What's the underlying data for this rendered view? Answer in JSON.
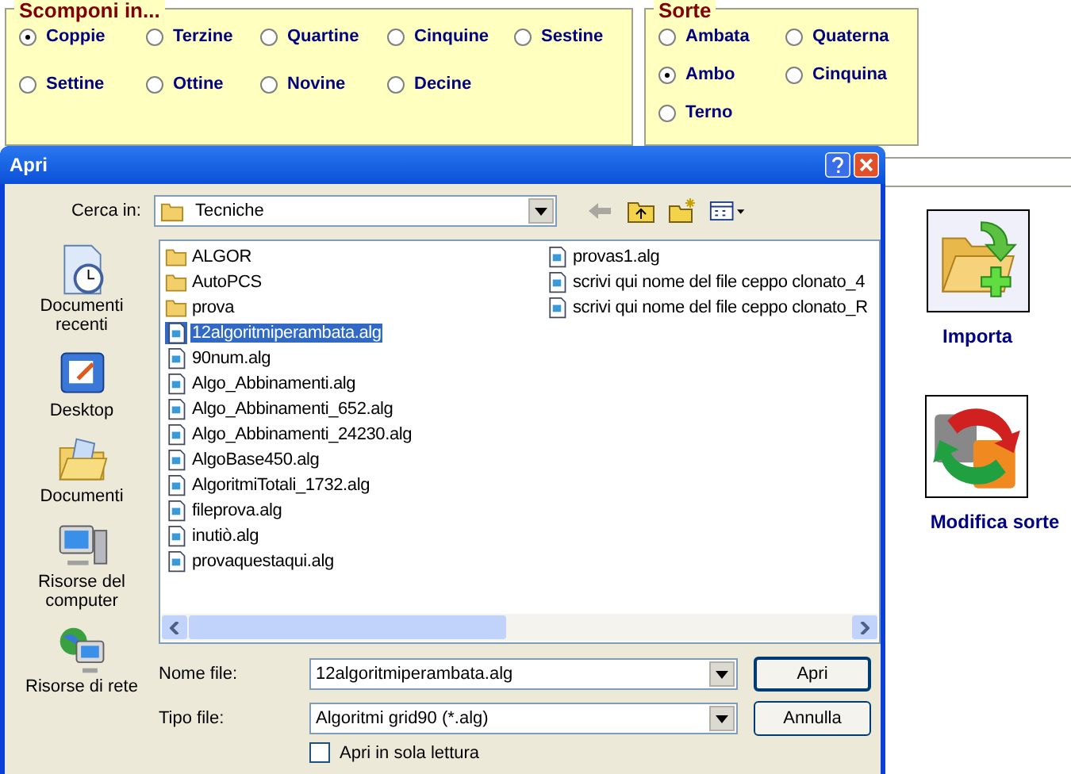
{
  "scomponi": {
    "title": "Scomponi in...",
    "options": [
      {
        "label": "Coppie",
        "selected": true
      },
      {
        "label": "Terzine",
        "selected": false
      },
      {
        "label": "Quartine",
        "selected": false
      },
      {
        "label": "Cinquine",
        "selected": false
      },
      {
        "label": "Sestine",
        "selected": false
      },
      {
        "label": "Settine",
        "selected": false
      },
      {
        "label": "Ottine",
        "selected": false
      },
      {
        "label": "Novine",
        "selected": false
      },
      {
        "label": "Decine",
        "selected": false
      }
    ]
  },
  "sorte": {
    "title": "Sorte",
    "options": [
      {
        "label": "Ambata",
        "selected": false
      },
      {
        "label": "Quaterna",
        "selected": false
      },
      {
        "label": "Ambo",
        "selected": true
      },
      {
        "label": "Cinquina",
        "selected": false
      },
      {
        "label": "Terno",
        "selected": false
      }
    ]
  },
  "actions": [
    {
      "kind": "import",
      "label": "Importa"
    },
    {
      "kind": "modify",
      "label": "Modifica sorte"
    }
  ],
  "dialog": {
    "title": "Apri",
    "look_in": {
      "label": "Cerca in:",
      "value": "Tecniche"
    },
    "places": [
      {
        "kind": "recent",
        "label": "Documenti recenti"
      },
      {
        "kind": "desktop",
        "label": "Desktop"
      },
      {
        "kind": "documents",
        "label": "Documenti"
      },
      {
        "kind": "computer",
        "label": "Risorse del computer"
      },
      {
        "kind": "network",
        "label": "Risorse di rete"
      }
    ],
    "file_columns": [
      [
        {
          "kind": "folder",
          "name": "ALGOR",
          "selected": false
        },
        {
          "kind": "folder",
          "name": "AutoPCS",
          "selected": false
        },
        {
          "kind": "folder",
          "name": "prova",
          "selected": false
        },
        {
          "kind": "file",
          "name": "12algoritmiperambata.alg",
          "selected": true
        },
        {
          "kind": "file",
          "name": "90num.alg",
          "selected": false
        },
        {
          "kind": "file",
          "name": "Algo_Abbinamenti.alg",
          "selected": false
        },
        {
          "kind": "file",
          "name": "Algo_Abbinamenti_652.alg",
          "selected": false
        },
        {
          "kind": "file",
          "name": "Algo_Abbinamenti_24230.alg",
          "selected": false
        },
        {
          "kind": "file",
          "name": "AlgoBase450.alg",
          "selected": false
        },
        {
          "kind": "file",
          "name": "AlgoritmiTotali_1732.alg",
          "selected": false
        },
        {
          "kind": "file",
          "name": "fileprova.alg",
          "selected": false
        },
        {
          "kind": "file",
          "name": "inutiò.alg",
          "selected": false
        },
        {
          "kind": "file",
          "name": "provaquestaqui.alg",
          "selected": false
        }
      ],
      [
        {
          "kind": "file",
          "name": "provas1.alg",
          "selected": false
        },
        {
          "kind": "file",
          "name": "scrivi qui nome del file ceppo clonato_4",
          "selected": false
        },
        {
          "kind": "file",
          "name": "scrivi qui nome del file ceppo clonato_R",
          "selected": false
        }
      ]
    ],
    "file_name": {
      "label": "Nome file:",
      "value": "12algoritmiperambata.alg"
    },
    "file_type": {
      "label": "Tipo file:",
      "value": "Algoritmi grid90 (*.alg)"
    },
    "buttons": [
      "Apri",
      "Annulla"
    ],
    "read_only": {
      "label": "Apri in sola lettura",
      "checked": false
    }
  }
}
